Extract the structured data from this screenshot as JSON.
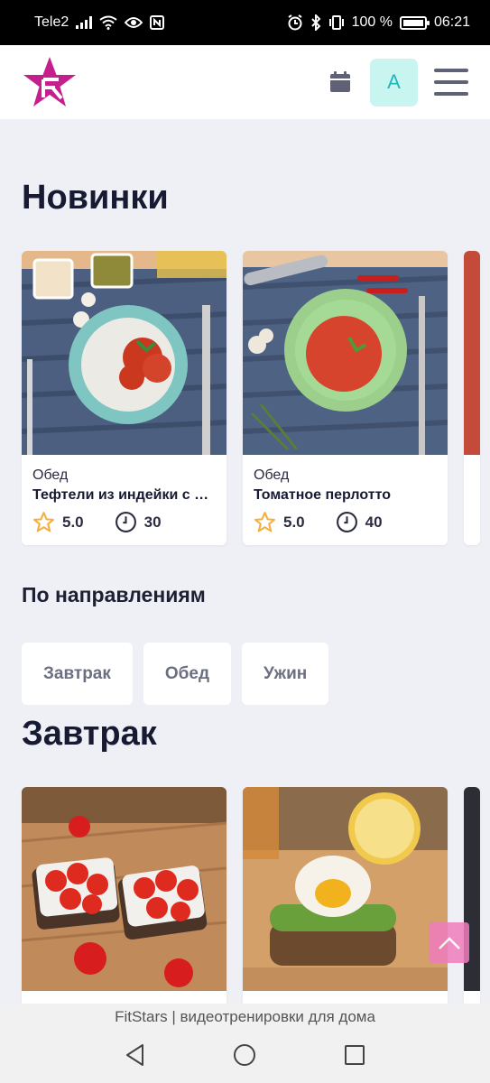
{
  "status_bar": {
    "carrier": "Tele2",
    "battery": "100 %",
    "time": "06:21"
  },
  "header": {
    "avatar_letter": "A"
  },
  "colors": {
    "brand_pink": "#c41f8d",
    "accent_teal": "#1db8bf",
    "star": "#f4b03e",
    "title": "#171a33",
    "background": "#eef0f6"
  },
  "sections": {
    "new": {
      "title": "Новинки",
      "cards": [
        {
          "category": "Обед",
          "title": "Тефтели из индейки с рисом",
          "rating": "5.0",
          "time": "30"
        },
        {
          "category": "Обед",
          "title": "Томатное перлотто",
          "rating": "5.0",
          "time": "40"
        }
      ]
    },
    "directions": {
      "title": "По направлениям",
      "chips": [
        "Завтрак",
        "Обед",
        "Ужин"
      ]
    },
    "breakfast": {
      "title": "Завтрак"
    }
  },
  "browser": {
    "page_title": "FitStars | видеотренировки для дома"
  },
  "icons": [
    "logo-star-icon",
    "calendar-icon",
    "menu-icon",
    "star-icon",
    "clock-icon",
    "chevron-up-icon",
    "back-icon",
    "home-icon",
    "recents-icon"
  ]
}
